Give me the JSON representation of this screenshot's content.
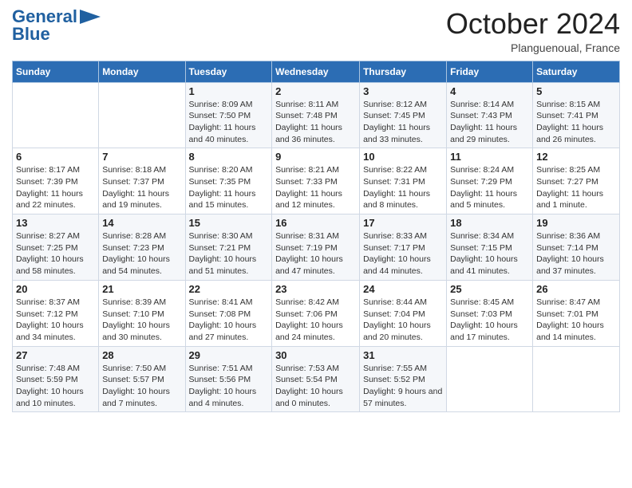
{
  "header": {
    "logo_line1": "General",
    "logo_line2": "Blue",
    "month": "October 2024",
    "location": "Planguenoual, France"
  },
  "days_of_week": [
    "Sunday",
    "Monday",
    "Tuesday",
    "Wednesday",
    "Thursday",
    "Friday",
    "Saturday"
  ],
  "weeks": [
    [
      {
        "day": "",
        "detail": ""
      },
      {
        "day": "",
        "detail": ""
      },
      {
        "day": "1",
        "detail": "Sunrise: 8:09 AM\nSunset: 7:50 PM\nDaylight: 11 hours and 40 minutes."
      },
      {
        "day": "2",
        "detail": "Sunrise: 8:11 AM\nSunset: 7:48 PM\nDaylight: 11 hours and 36 minutes."
      },
      {
        "day": "3",
        "detail": "Sunrise: 8:12 AM\nSunset: 7:45 PM\nDaylight: 11 hours and 33 minutes."
      },
      {
        "day": "4",
        "detail": "Sunrise: 8:14 AM\nSunset: 7:43 PM\nDaylight: 11 hours and 29 minutes."
      },
      {
        "day": "5",
        "detail": "Sunrise: 8:15 AM\nSunset: 7:41 PM\nDaylight: 11 hours and 26 minutes."
      }
    ],
    [
      {
        "day": "6",
        "detail": "Sunrise: 8:17 AM\nSunset: 7:39 PM\nDaylight: 11 hours and 22 minutes."
      },
      {
        "day": "7",
        "detail": "Sunrise: 8:18 AM\nSunset: 7:37 PM\nDaylight: 11 hours and 19 minutes."
      },
      {
        "day": "8",
        "detail": "Sunrise: 8:20 AM\nSunset: 7:35 PM\nDaylight: 11 hours and 15 minutes."
      },
      {
        "day": "9",
        "detail": "Sunrise: 8:21 AM\nSunset: 7:33 PM\nDaylight: 11 hours and 12 minutes."
      },
      {
        "day": "10",
        "detail": "Sunrise: 8:22 AM\nSunset: 7:31 PM\nDaylight: 11 hours and 8 minutes."
      },
      {
        "day": "11",
        "detail": "Sunrise: 8:24 AM\nSunset: 7:29 PM\nDaylight: 11 hours and 5 minutes."
      },
      {
        "day": "12",
        "detail": "Sunrise: 8:25 AM\nSunset: 7:27 PM\nDaylight: 11 hours and 1 minute."
      }
    ],
    [
      {
        "day": "13",
        "detail": "Sunrise: 8:27 AM\nSunset: 7:25 PM\nDaylight: 10 hours and 58 minutes."
      },
      {
        "day": "14",
        "detail": "Sunrise: 8:28 AM\nSunset: 7:23 PM\nDaylight: 10 hours and 54 minutes."
      },
      {
        "day": "15",
        "detail": "Sunrise: 8:30 AM\nSunset: 7:21 PM\nDaylight: 10 hours and 51 minutes."
      },
      {
        "day": "16",
        "detail": "Sunrise: 8:31 AM\nSunset: 7:19 PM\nDaylight: 10 hours and 47 minutes."
      },
      {
        "day": "17",
        "detail": "Sunrise: 8:33 AM\nSunset: 7:17 PM\nDaylight: 10 hours and 44 minutes."
      },
      {
        "day": "18",
        "detail": "Sunrise: 8:34 AM\nSunset: 7:15 PM\nDaylight: 10 hours and 41 minutes."
      },
      {
        "day": "19",
        "detail": "Sunrise: 8:36 AM\nSunset: 7:14 PM\nDaylight: 10 hours and 37 minutes."
      }
    ],
    [
      {
        "day": "20",
        "detail": "Sunrise: 8:37 AM\nSunset: 7:12 PM\nDaylight: 10 hours and 34 minutes."
      },
      {
        "day": "21",
        "detail": "Sunrise: 8:39 AM\nSunset: 7:10 PM\nDaylight: 10 hours and 30 minutes."
      },
      {
        "day": "22",
        "detail": "Sunrise: 8:41 AM\nSunset: 7:08 PM\nDaylight: 10 hours and 27 minutes."
      },
      {
        "day": "23",
        "detail": "Sunrise: 8:42 AM\nSunset: 7:06 PM\nDaylight: 10 hours and 24 minutes."
      },
      {
        "day": "24",
        "detail": "Sunrise: 8:44 AM\nSunset: 7:04 PM\nDaylight: 10 hours and 20 minutes."
      },
      {
        "day": "25",
        "detail": "Sunrise: 8:45 AM\nSunset: 7:03 PM\nDaylight: 10 hours and 17 minutes."
      },
      {
        "day": "26",
        "detail": "Sunrise: 8:47 AM\nSunset: 7:01 PM\nDaylight: 10 hours and 14 minutes."
      }
    ],
    [
      {
        "day": "27",
        "detail": "Sunrise: 7:48 AM\nSunset: 5:59 PM\nDaylight: 10 hours and 10 minutes."
      },
      {
        "day": "28",
        "detail": "Sunrise: 7:50 AM\nSunset: 5:57 PM\nDaylight: 10 hours and 7 minutes."
      },
      {
        "day": "29",
        "detail": "Sunrise: 7:51 AM\nSunset: 5:56 PM\nDaylight: 10 hours and 4 minutes."
      },
      {
        "day": "30",
        "detail": "Sunrise: 7:53 AM\nSunset: 5:54 PM\nDaylight: 10 hours and 0 minutes."
      },
      {
        "day": "31",
        "detail": "Sunrise: 7:55 AM\nSunset: 5:52 PM\nDaylight: 9 hours and 57 minutes."
      },
      {
        "day": "",
        "detail": ""
      },
      {
        "day": "",
        "detail": ""
      }
    ]
  ]
}
